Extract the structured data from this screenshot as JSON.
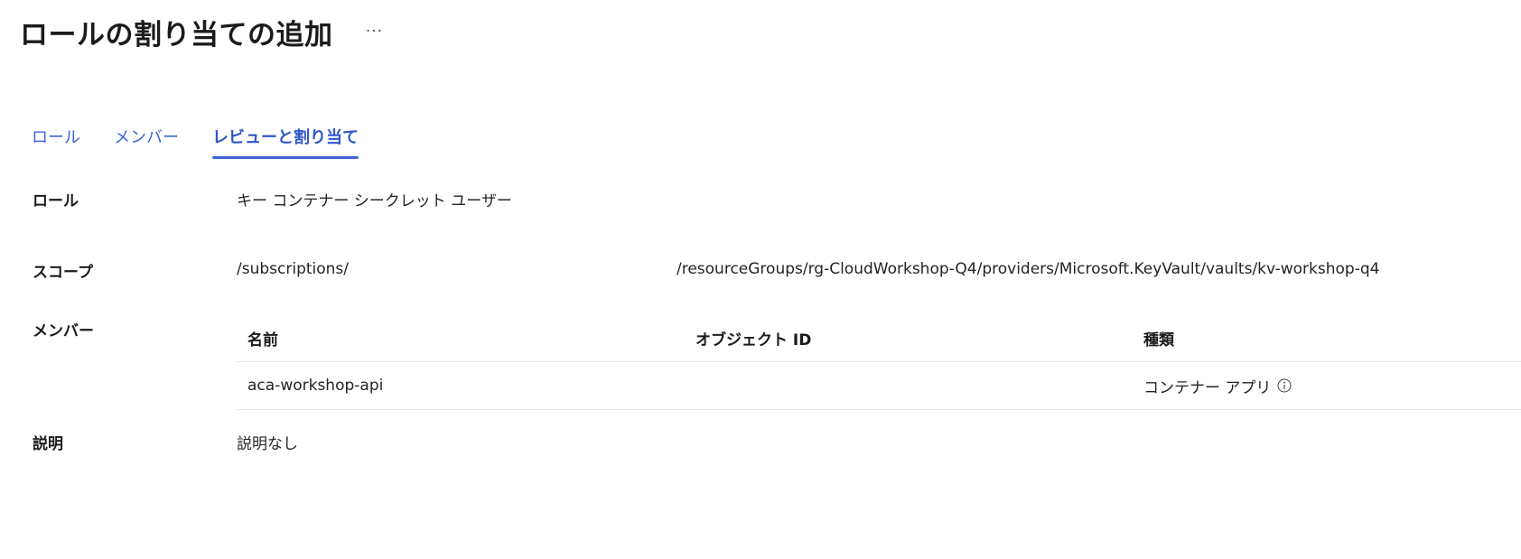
{
  "header": {
    "title": "ロールの割り当ての追加",
    "more_label": "···"
  },
  "tabs": [
    {
      "label": "ロール"
    },
    {
      "label": "メンバー"
    },
    {
      "label": "レビューと割り当て",
      "active": true
    }
  ],
  "details": {
    "role_label": "ロール",
    "role_value": "キー コンテナー シークレット ユーザー",
    "scope_label": "スコープ",
    "scope_prefix": "/subscriptions/",
    "scope_suffix": "/resourceGroups/rg-CloudWorkshop-Q4/providers/Microsoft.KeyVault/vaults/kv-workshop-q4",
    "members_label": "メンバー",
    "description_label": "説明",
    "description_value": "説明なし"
  },
  "members_table": {
    "columns": [
      "名前",
      "オブジェクト ID",
      "種類"
    ],
    "rows": [
      {
        "name": "aca-workshop-api",
        "object_id": "",
        "type": "コンテナー アプリ"
      }
    ]
  },
  "icons": {
    "more": "more-horizontal-icon",
    "type_info": "info-icon"
  },
  "colors": {
    "accent": "#3e63d6",
    "text": "#242424",
    "divider": "#e6e6e6"
  }
}
